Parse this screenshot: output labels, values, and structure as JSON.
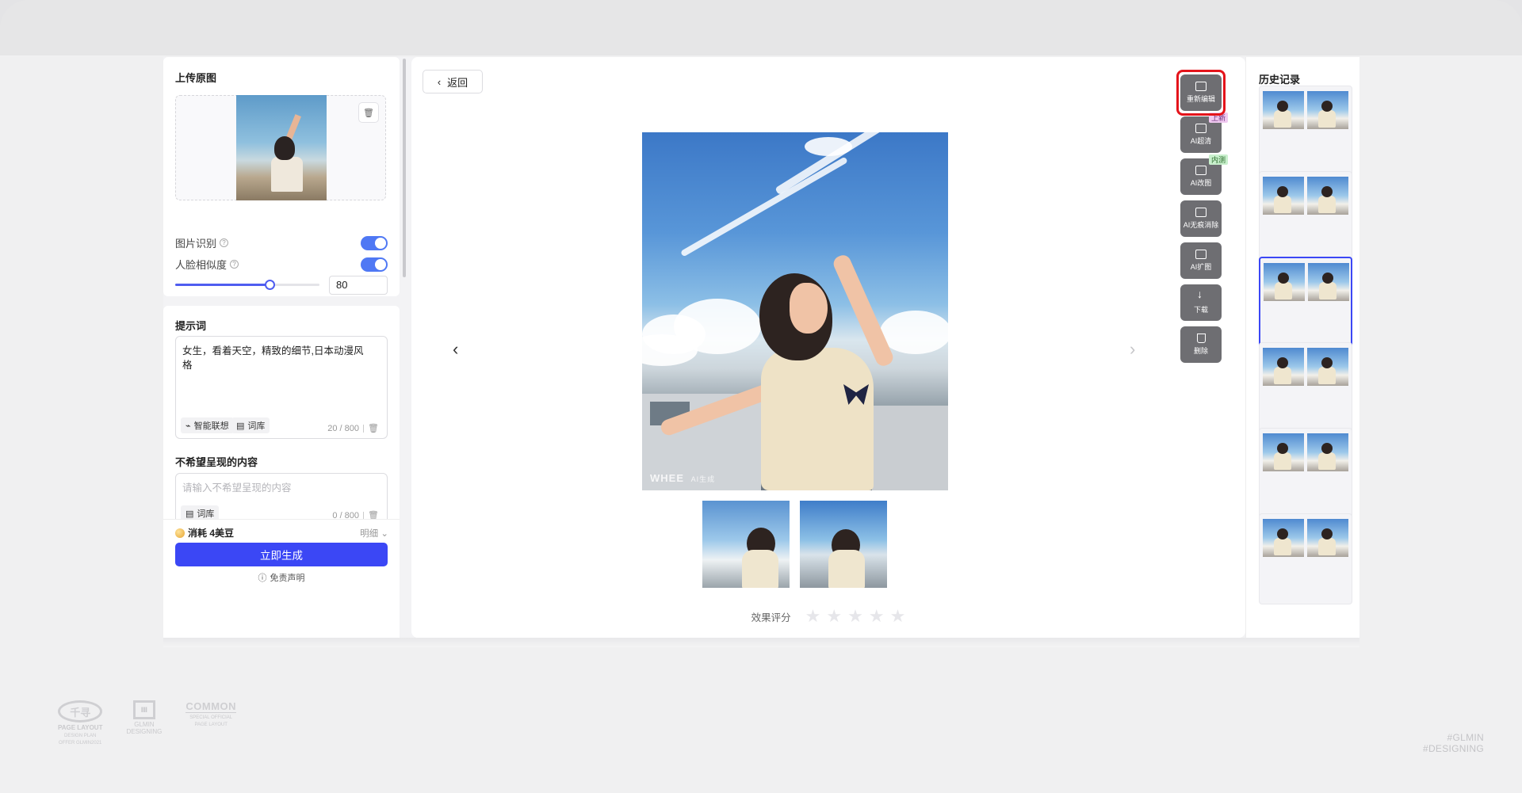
{
  "left_panel": {
    "upload_title": "上传原图",
    "image_recognition_label": "图片识别",
    "face_similarity_label": "人脸相似度",
    "image_recognition_on": true,
    "face_similarity_on": true,
    "similarity_value": "80",
    "similarity_fraction": 0.8,
    "prompt_title": "提示词",
    "prompt_text": "女生，看着天空，精致的细节,日本动漫风格",
    "smart_assoc_label": "智能联想",
    "lexicon_label": "词库",
    "prompt_counter": "20 / 800",
    "negative_title": "不希望呈现的内容",
    "negative_placeholder": "请输入不希望呈现的内容",
    "negative_lexicon_label": "词库",
    "negative_counter": "0 / 800",
    "cost_label": "消耗 4美豆",
    "detail_label": "明细",
    "generate_button": "立即生成",
    "disclaimer": "免责声明"
  },
  "center": {
    "back_label": "返回",
    "watermark": "WHEE",
    "watermark_small": "AI生成",
    "rating_label": "效果评分",
    "rating_max": 5,
    "rating_value": 0
  },
  "tools": [
    {
      "label": "重新编辑",
      "icon": "image-edit-icon"
    },
    {
      "label": "AI超清",
      "icon": "hd-icon",
      "tag": "上新"
    },
    {
      "label": "AI改图",
      "icon": "magic-wand-icon",
      "tag": "内测"
    },
    {
      "label": "AI无痕消除",
      "icon": "eraser-icon"
    },
    {
      "label": "AI扩图",
      "icon": "expand-icon"
    },
    {
      "label": "下载",
      "icon": "download-icon"
    },
    {
      "label": "删除",
      "icon": "trash-icon"
    }
  ],
  "history": {
    "title": "历史记录",
    "selected_index": 2
  },
  "footer": {
    "logo1_text": "千寻",
    "logo1_caption": "PAGE LAYOUT",
    "logo1_sub": "DESIGN PLAN\nOFFER GLMIN2021",
    "logo2_caption": "GLMIN\nDESIGNING",
    "logo3_text": "COMMON",
    "logo3_sub": "SPECIAL OFFICIAL\nPAGE LAYOUT",
    "hash1": "#GLMIN",
    "hash2": "#DESIGNING"
  },
  "colors": {
    "primary": "#3b47f5",
    "toggle": "#4f78f4",
    "highlight": "#e4141b",
    "tool_bg": "#6e6e72"
  }
}
